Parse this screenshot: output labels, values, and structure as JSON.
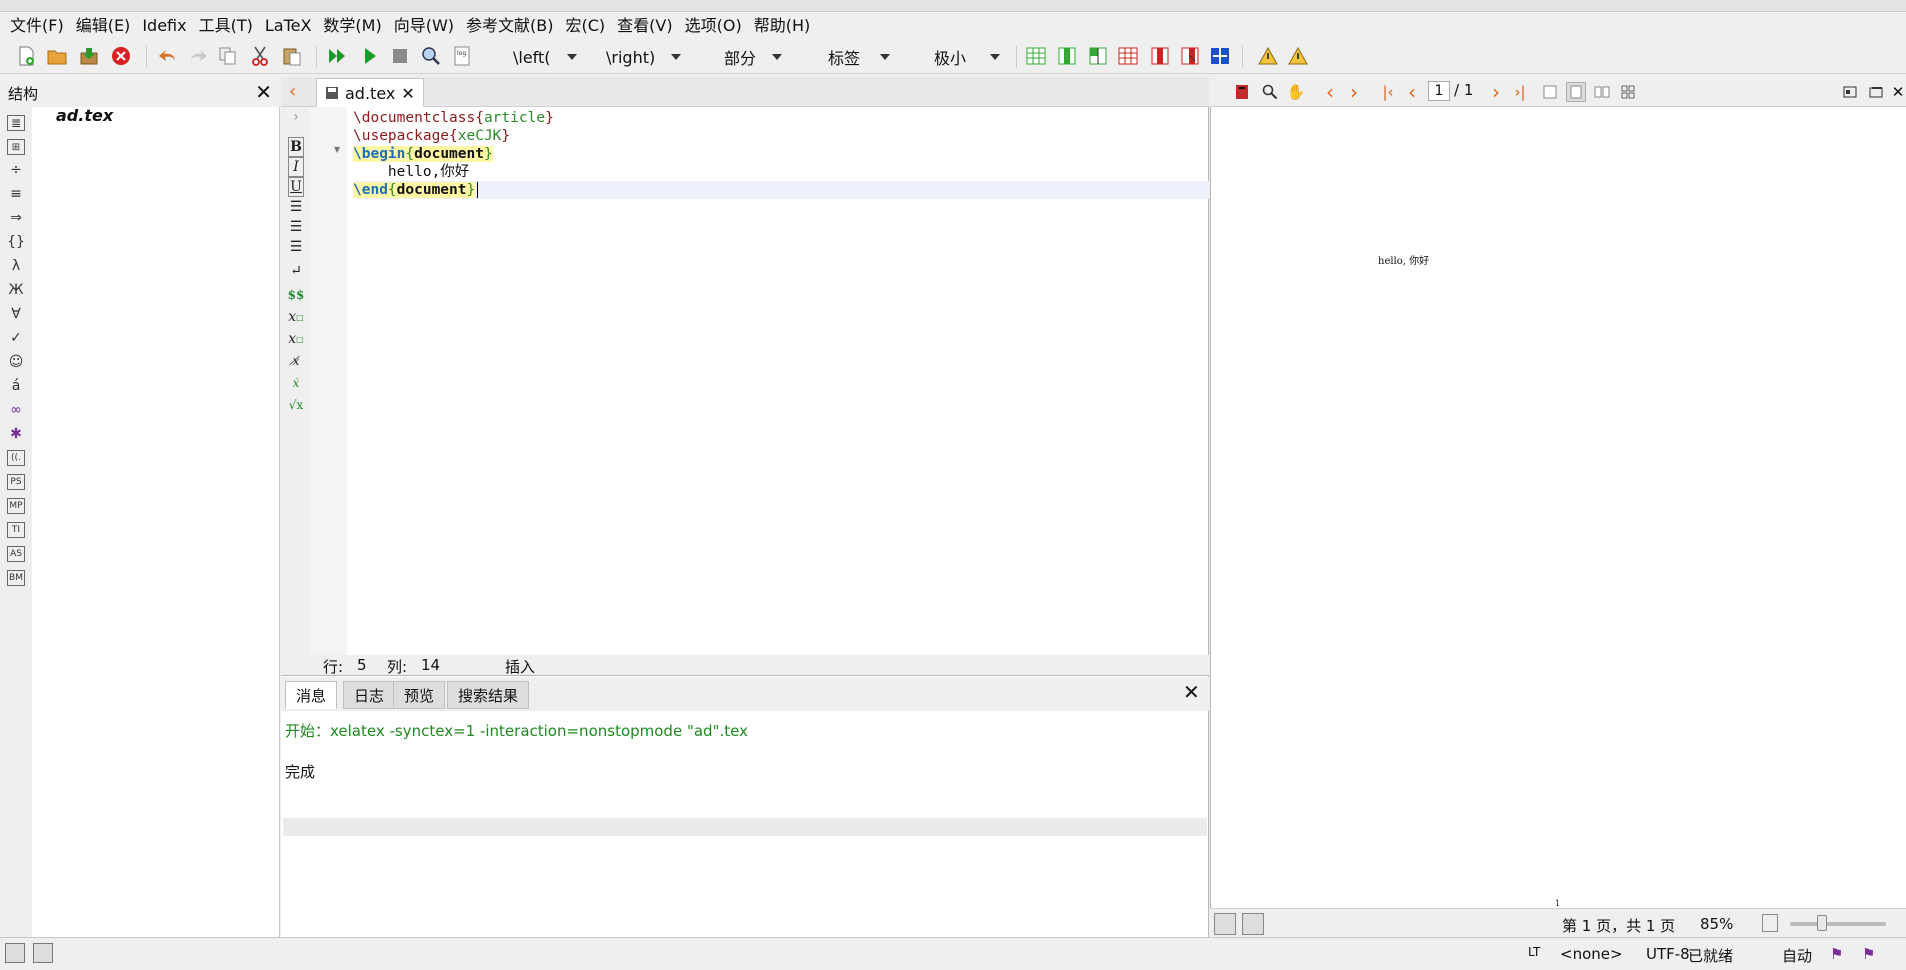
{
  "menu": [
    "文件(F)",
    "编辑(E)",
    "Idefix",
    "工具(T)",
    "LaTeX",
    "数学(M)",
    "向导(W)",
    "参考文献(B)",
    "宏(C)",
    "查看(V)",
    "选项(O)",
    "帮助(H)"
  ],
  "toolbar": {
    "left_combo": "\\left(",
    "right_combo": "\\right)",
    "section_combo": "部分",
    "label_combo": "标签",
    "size_combo": "极小"
  },
  "structure": {
    "title": "结构",
    "close": "✕",
    "file": "ad.tex",
    "icons": [
      "≣",
      "⊞",
      "÷",
      "≡",
      "⇒",
      "{}",
      "λ",
      "Ж",
      "∀",
      "✓",
      "☺",
      "á",
      "∞",
      "✱",
      "((.",
      "PS",
      "MP",
      "TI",
      "AS",
      "BM"
    ]
  },
  "editor": {
    "tab_label": "ad.tex",
    "tab_close": "✕",
    "lines": [
      {
        "cmd": "\\documentclass",
        "arg": "article"
      },
      {
        "cmd": "\\usepackage",
        "arg": "xeCJK"
      },
      {
        "cmd": "\\begin",
        "arg": "document"
      },
      {
        "text": "    hello,你好"
      },
      {
        "cmd": "\\end",
        "arg": "document"
      }
    ],
    "status": {
      "row_label": "行:",
      "row": "5",
      "col_label": "列:",
      "col": "14",
      "mode": "插入"
    }
  },
  "messages": {
    "tabs": [
      "消息",
      "日志",
      "预览",
      "搜索结果"
    ],
    "close": "✕",
    "line1": "开始：xelatex -synctex=1 -interaction=nonstopmode \"ad\".tex",
    "line2": "完成"
  },
  "pdf": {
    "page_current": "1",
    "page_total": "/ 1",
    "content_text": "hello, 你好",
    "page_number": "1",
    "page_info": "第 1 页，共 1 页",
    "zoom": "85%",
    "zoom_level": 0.33
  },
  "statusbar": {
    "lt": "LT",
    "language": "<none>",
    "encoding": "UTF-8",
    "ready": "已就绪",
    "auto": "自动"
  }
}
